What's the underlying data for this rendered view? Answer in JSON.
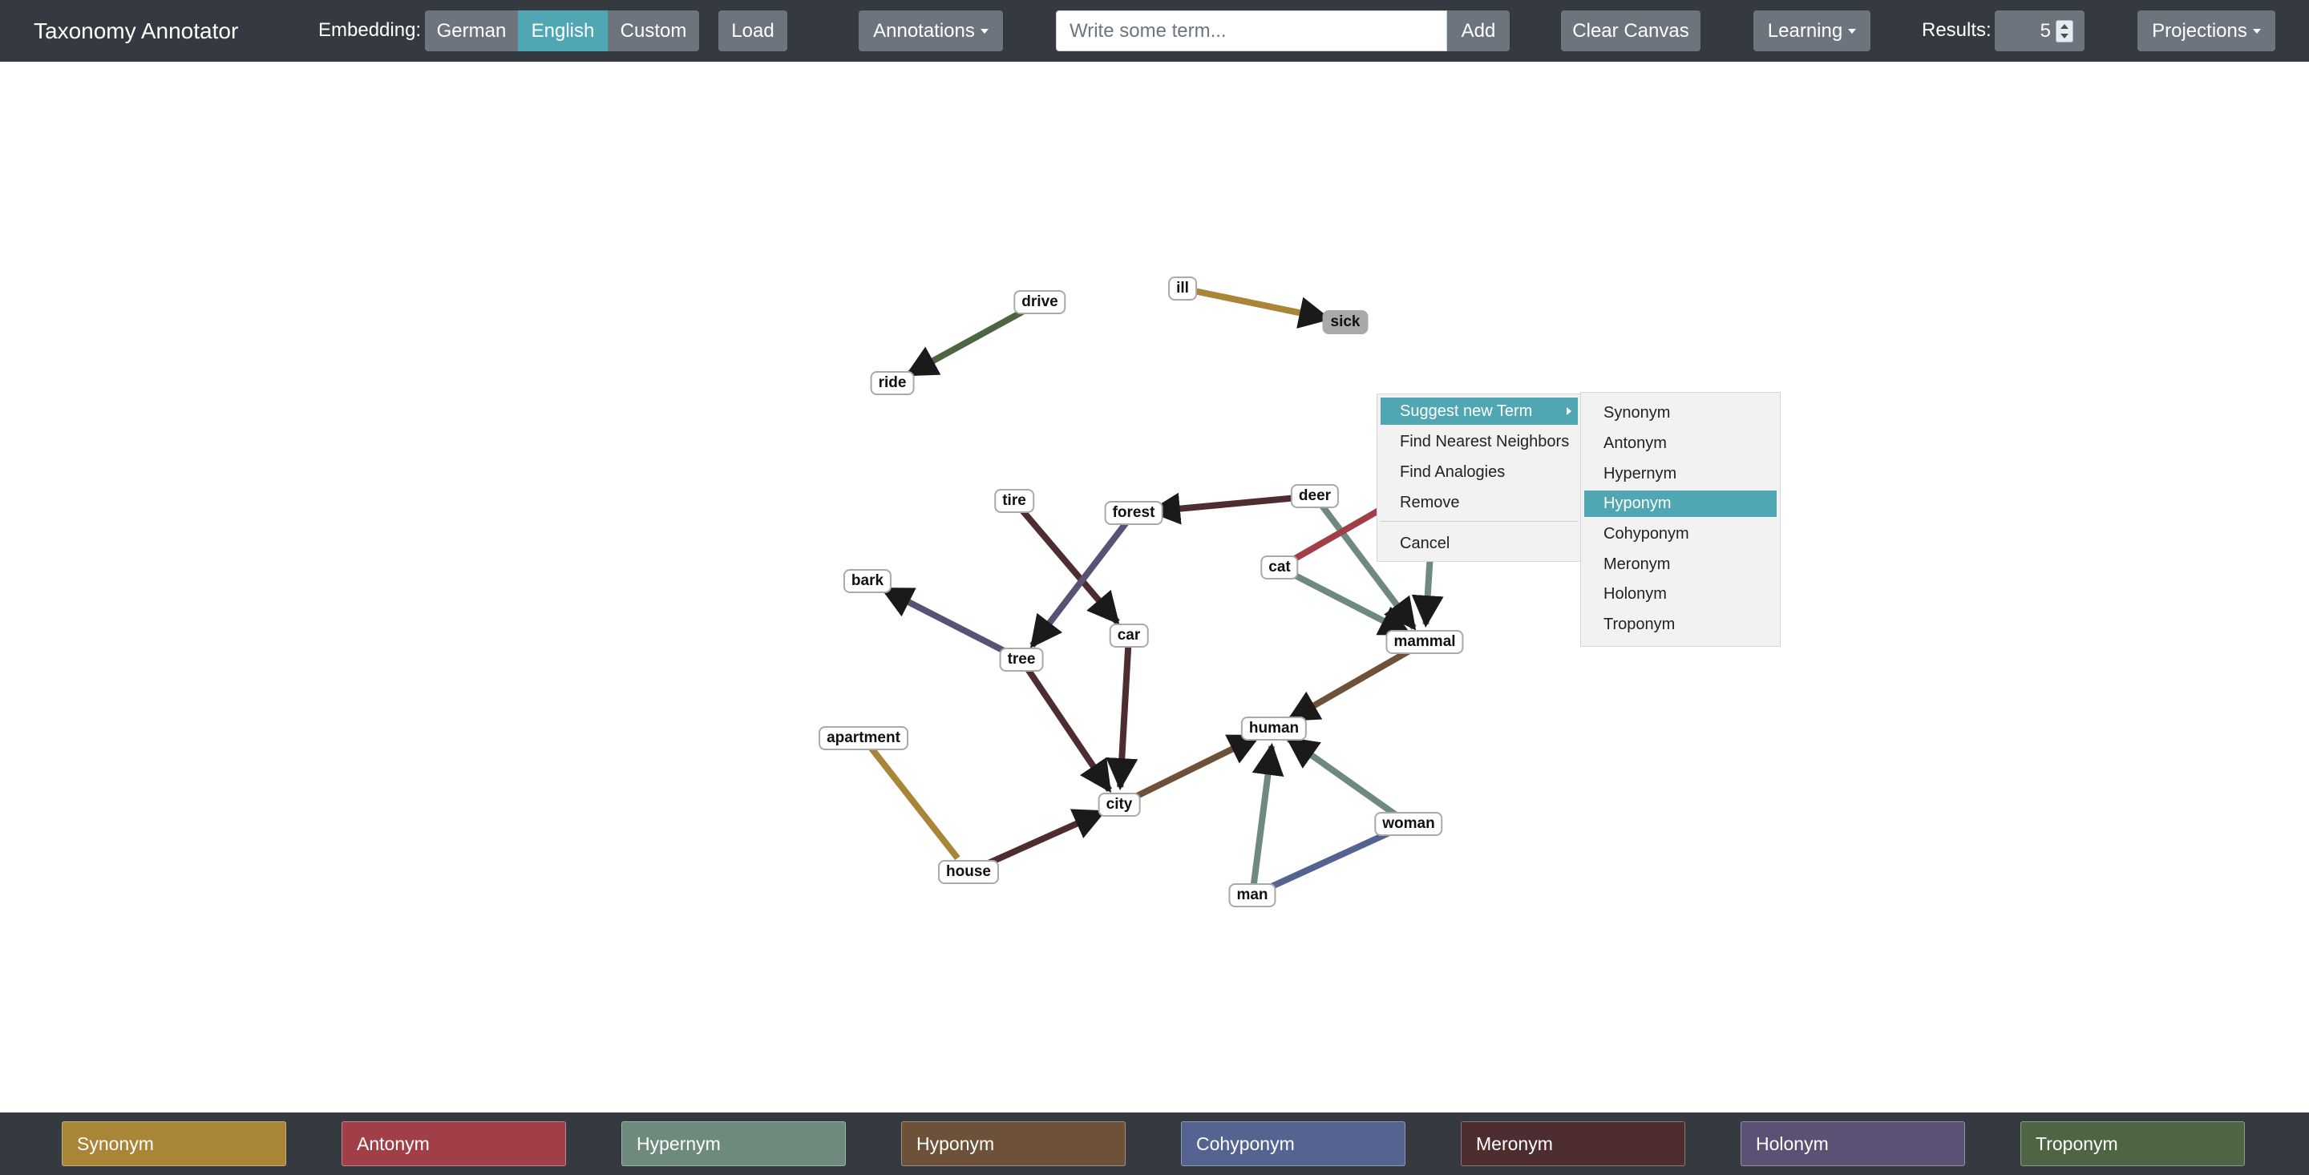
{
  "app": {
    "title": "Taxonomy Annotator"
  },
  "toolbar": {
    "embedding_label": "Embedding:",
    "embeddings": [
      "German",
      "English",
      "Custom"
    ],
    "active_embedding": "English",
    "load_label": "Load",
    "annotations_label": "Annotations",
    "term_input": {
      "value": "",
      "placeholder": "Write some term..."
    },
    "add_label": "Add",
    "clear_canvas_label": "Clear Canvas",
    "learning_label": "Learning",
    "results_label": "Results:",
    "results_value": "5",
    "projections_label": "Projections"
  },
  "graph": {
    "nodes": [
      {
        "id": "drive",
        "label": "drive"
      },
      {
        "id": "ride",
        "label": "ride"
      },
      {
        "id": "ill",
        "label": "ill"
      },
      {
        "id": "sick",
        "label": "sick",
        "selected": true
      },
      {
        "id": "tire",
        "label": "tire"
      },
      {
        "id": "forest",
        "label": "forest"
      },
      {
        "id": "deer",
        "label": "deer"
      },
      {
        "id": "cat",
        "label": "cat"
      },
      {
        "id": "bark",
        "label": "bark"
      },
      {
        "id": "car",
        "label": "car"
      },
      {
        "id": "tree",
        "label": "tree"
      },
      {
        "id": "mammal",
        "label": "mammal"
      },
      {
        "id": "apartment",
        "label": "apartment"
      },
      {
        "id": "human",
        "label": "human"
      },
      {
        "id": "city",
        "label": "city"
      },
      {
        "id": "woman",
        "label": "woman"
      },
      {
        "id": "house",
        "label": "house"
      },
      {
        "id": "man",
        "label": "man"
      }
    ],
    "edges": [
      {
        "source": "drive",
        "target": "ride",
        "relation": "Troponym"
      },
      {
        "source": "ill",
        "target": "sick",
        "relation": "Synonym"
      },
      {
        "source": "deer",
        "target": "forest",
        "relation": "Meronym"
      },
      {
        "source": "tire",
        "target": "car",
        "relation": "Meronym"
      },
      {
        "source": "forest",
        "target": "tree",
        "relation": "Holonym"
      },
      {
        "source": "tree",
        "target": "bark",
        "relation": "Holonym"
      },
      {
        "source": "tree",
        "target": "city",
        "relation": "Meronym"
      },
      {
        "source": "car",
        "target": "city",
        "relation": "Meronym"
      },
      {
        "source": "apartment",
        "target": "house",
        "relation": "Synonym"
      },
      {
        "source": "house",
        "target": "city",
        "relation": "Meronym"
      },
      {
        "source": "city",
        "target": "human",
        "relation": "Hyponym"
      },
      {
        "source": "deer",
        "target": "mammal",
        "relation": "Hypernym"
      },
      {
        "source": "cat",
        "target": "mammal",
        "relation": "Hypernym"
      },
      {
        "source": "cat",
        "target": "hidden-right",
        "relation": "Antonym"
      },
      {
        "source": "hidden-top",
        "target": "mammal",
        "relation": "Hypernym"
      },
      {
        "source": "mammal",
        "target": "human",
        "relation": "Hyponym"
      },
      {
        "source": "woman",
        "target": "human",
        "relation": "Hypernym"
      },
      {
        "source": "man",
        "target": "human",
        "relation": "Hypernym"
      },
      {
        "source": "man",
        "target": "woman",
        "relation": "Cohyponym"
      }
    ]
  },
  "context_menu": {
    "items": [
      "Suggest new Term",
      "Find Nearest Neighbors",
      "Find Analogies",
      "Remove",
      "Cancel"
    ],
    "highlighted": "Suggest new Term"
  },
  "submenu": {
    "items": [
      "Synonym",
      "Antonym",
      "Hypernym",
      "Hyponym",
      "Cohyponym",
      "Meronym",
      "Holonym",
      "Troponym"
    ],
    "highlighted": "Hyponym"
  },
  "legend": [
    {
      "label": "Synonym",
      "color": "#a88537"
    },
    {
      "label": "Antonym",
      "color": "#a13f49"
    },
    {
      "label": "Hypernym",
      "color": "#6e8a7d"
    },
    {
      "label": "Hyponym",
      "color": "#6d5138"
    },
    {
      "label": "Cohyponym",
      "color": "#54638f"
    },
    {
      "label": "Meronym",
      "color": "#4e2d30"
    },
    {
      "label": "Holonym",
      "color": "#5a5175"
    },
    {
      "label": "Troponym",
      "color": "#4e6544"
    }
  ]
}
